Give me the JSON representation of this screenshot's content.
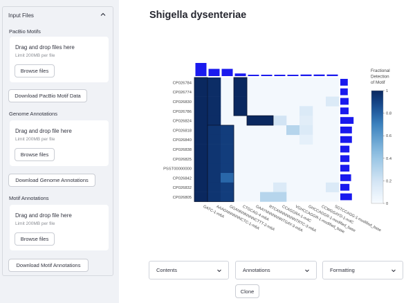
{
  "sidebar": {
    "expander_title": "Input Files",
    "sections": [
      {
        "label": "PacBio Motifs",
        "drop_title": "Drag and drop files here",
        "limit": "Limit 200MB per file",
        "browse": "Browse files",
        "download": "Download PacBio Motif Data"
      },
      {
        "label": "Genome Annotations",
        "drop_title": "Drag and drop file here",
        "limit": "Limit 200MB per file",
        "browse": "Browse files",
        "download": "Download Genome Annotations"
      },
      {
        "label": "Motif Annotations",
        "drop_title": "Drag and drop file here",
        "limit": "Limit 200MB per file",
        "browse": "Browse files",
        "download": "Download Motif Annotations"
      }
    ]
  },
  "main": {
    "title": "Shigella dysenteriae",
    "controls": {
      "contents": "Contents",
      "annotations": "Annotations",
      "formatting": "Formatting",
      "clone": "Clone"
    }
  },
  "colors": {
    "dark": "#0b2a5b",
    "mid": "#1d5a9e",
    "light": "#bcd7ee",
    "pale": "#eaf2fa",
    "bar": "#1a1aee"
  },
  "chart_data": {
    "type": "heatmap",
    "rows": [
      "CP026784",
      "CP026774",
      "CP026830",
      "CP026786",
      "CP026824",
      "CP026818",
      "CP026840",
      "CP026838",
      "CP026825",
      "PSST00000000",
      "CP026842",
      "CP026832",
      "CP026805"
    ],
    "columns": [
      "GATC-1-m6A",
      "AAAGNNNNNNCTC-1-m6A",
      "GGANNNNNNNCTTT-2-m6A",
      "CTGCAG-4-m6A",
      "GAAYNNNNNNNTGAY-3-m6A",
      "RTCANNNNNNNTRTC-3-m6A",
      "CCAGGRA-1-m4C",
      "VGHCCAGGR-1-modified_base",
      "GHCCAGGR-1-modified_base",
      "CCWGGAYD-1-m4C",
      "SGTCCAGG-1-modified_base"
    ],
    "values": [
      [
        1.0,
        0.98,
        0.0,
        1.0,
        0.0,
        0.0,
        0.0,
        0.0,
        0.0,
        0.0,
        0.0
      ],
      [
        1.0,
        0.98,
        0.0,
        1.0,
        0.0,
        0.0,
        0.0,
        0.0,
        0.0,
        0.0,
        0.0
      ],
      [
        1.0,
        0.98,
        0.0,
        1.0,
        0.0,
        0.0,
        0.0,
        0.0,
        0.0,
        0.0,
        0.15
      ],
      [
        1.0,
        0.98,
        0.0,
        1.0,
        0.0,
        0.0,
        0.0,
        0.0,
        0.15,
        0.0,
        0.0
      ],
      [
        1.0,
        0.98,
        0.0,
        0.0,
        1.0,
        1.0,
        0.2,
        0.0,
        0.12,
        0.0,
        0.0
      ],
      [
        1.0,
        0.95,
        0.92,
        0.0,
        0.0,
        0.0,
        0.0,
        0.3,
        0.15,
        0.0,
        0.0
      ],
      [
        1.0,
        0.95,
        0.92,
        0.0,
        0.0,
        0.0,
        0.0,
        0.0,
        0.1,
        0.0,
        0.0
      ],
      [
        1.0,
        0.95,
        0.92,
        0.0,
        0.0,
        0.0,
        0.0,
        0.0,
        0.0,
        0.0,
        0.0
      ],
      [
        1.0,
        0.95,
        0.92,
        0.0,
        0.0,
        0.0,
        0.0,
        0.0,
        0.0,
        0.0,
        0.0
      ],
      [
        1.0,
        0.95,
        0.92,
        0.0,
        0.0,
        0.0,
        0.0,
        0.0,
        0.0,
        0.0,
        0.0
      ],
      [
        1.0,
        0.95,
        0.78,
        0.0,
        0.0,
        0.0,
        0.0,
        0.0,
        0.0,
        0.0,
        0.0
      ],
      [
        1.0,
        0.95,
        0.92,
        0.0,
        0.0,
        0.0,
        0.15,
        0.0,
        0.0,
        0.0,
        0.15
      ],
      [
        1.0,
        0.95,
        0.92,
        0.0,
        0.0,
        0.3,
        0.3,
        0.0,
        0.0,
        0.0,
        0.0
      ]
    ],
    "col_bars": [
      1.0,
      0.55,
      0.55,
      0.2,
      0.08,
      0.08,
      0.08,
      0.08,
      0.12,
      0.12,
      0.12
    ],
    "row_bars": [
      0.45,
      0.45,
      0.5,
      0.5,
      0.8,
      0.7,
      0.7,
      0.55,
      0.55,
      0.55,
      0.65,
      0.55,
      0.7
    ],
    "colorbar_title": [
      "Fractional",
      "Detection",
      "of Motif"
    ],
    "colorbar_ticks": [
      "0",
      "0.2",
      "0.4",
      "0.6",
      "0.8",
      "1"
    ],
    "vmin": 0,
    "vmax": 1
  }
}
